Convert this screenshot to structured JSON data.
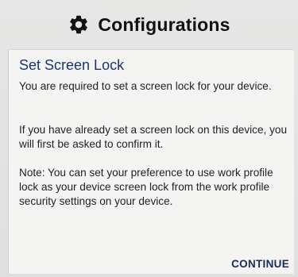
{
  "header": {
    "title": "Configurations",
    "icon": "gear-icon"
  },
  "dialog": {
    "title": "Set Screen Lock",
    "paragraphs": [
      "You are required to set a screen lock for your device.",
      "If you have already set a screen lock on this device, you will first be asked to confirm it.",
      "Note: You can set your preference to use work profile lock as your device screen lock from the work profile security settings on your device."
    ],
    "continue_label": "CONTINUE"
  },
  "colors": {
    "background": "#e4e5e4",
    "dialog_title": "#1c3570",
    "button_text": "#1a2a55"
  }
}
